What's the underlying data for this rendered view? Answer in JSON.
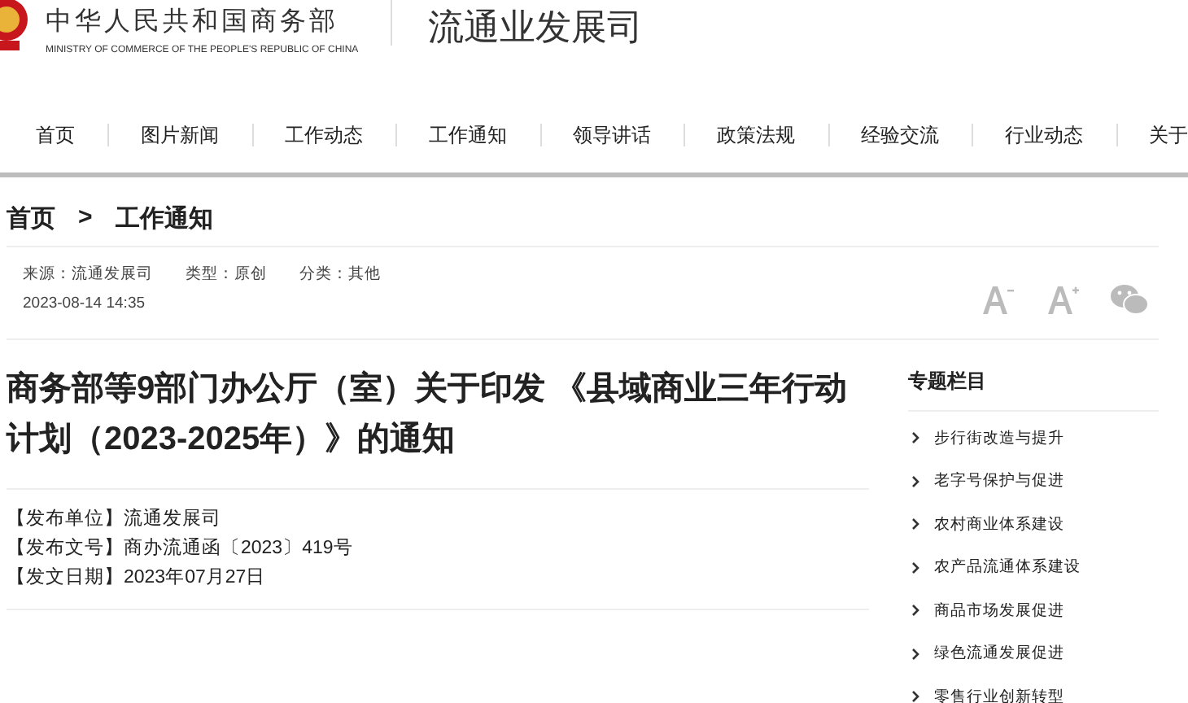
{
  "header": {
    "ministry_name": "中华人民共和国商务部",
    "ministry_name_en": "MINISTRY OF COMMERCE OF THE PEOPLE'S REPUBLIC OF CHINA",
    "department": "流通业发展司"
  },
  "nav": [
    {
      "label": "首页"
    },
    {
      "label": "图片新闻"
    },
    {
      "label": "工作动态"
    },
    {
      "label": "工作通知"
    },
    {
      "label": "领导讲话"
    },
    {
      "label": "政策法规"
    },
    {
      "label": "经验交流"
    },
    {
      "label": "行业动态"
    },
    {
      "label": "关于"
    }
  ],
  "breadcrumb": {
    "home": "首页",
    "separator": ">",
    "current": "工作通知"
  },
  "meta": {
    "source": "来源：流通发展司",
    "type": "类型：原创",
    "category": "分类：其他",
    "datetime": "2023-08-14 14:35"
  },
  "article": {
    "title": "商务部等9部门办公厅（室）关于印发 《县域商业三年行动计划（2023-2025年）》的通知",
    "info": [
      "【发布单位】流通发展司",
      "【发布文号】商办流通函〔2023〕419号",
      "【发文日期】2023年07月27日"
    ]
  },
  "sidebar": {
    "title": "专题栏目",
    "items": [
      "步行街改造与提升",
      "老字号保护与促进",
      "农村商业体系建设",
      "农产品流通体系建设",
      "商品市场发展促进",
      "绿色流通发展促进",
      "零售行业创新转型"
    ]
  }
}
